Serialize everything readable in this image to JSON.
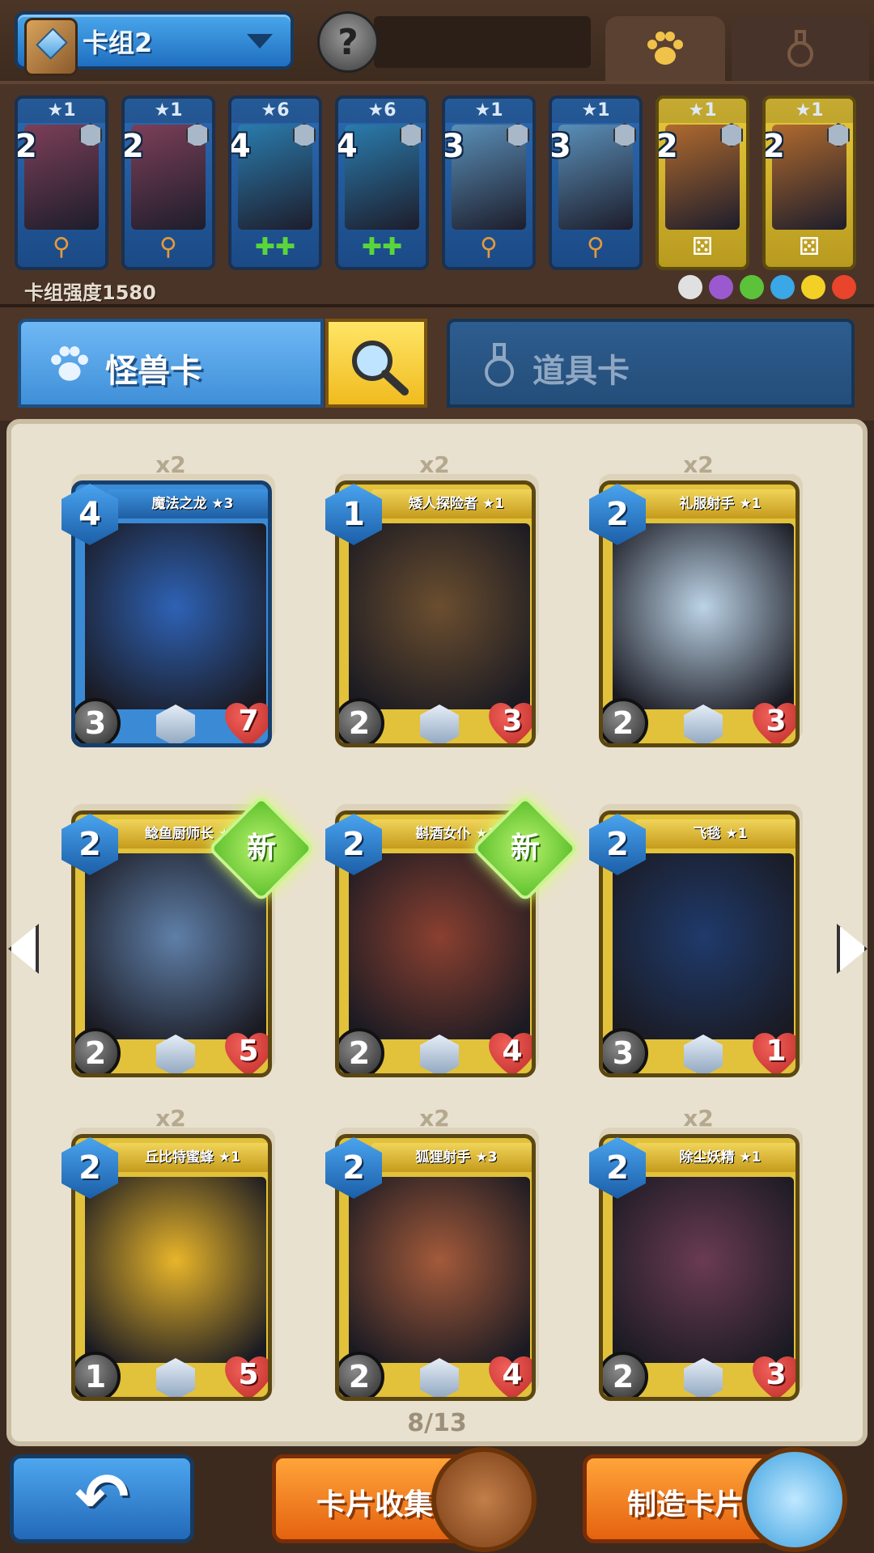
{
  "header": {
    "deck_name": "卡组2",
    "avatar_glyph": "?",
    "tabs": [
      {
        "id": "monsters",
        "icon": "paw-icon",
        "active": true
      },
      {
        "id": "items",
        "icon": "potion-flask-icon",
        "active": false
      }
    ]
  },
  "deck": {
    "cards": [
      {
        "stars": "★1",
        "cost": "2",
        "frame": "blue",
        "art_color": "#7c3f58",
        "ability_icon": "staff-icon",
        "ability_glyph": "⚲"
      },
      {
        "stars": "★1",
        "cost": "2",
        "frame": "blue",
        "art_color": "#7c3f58",
        "ability_icon": "staff-icon",
        "ability_glyph": "⚲"
      },
      {
        "stars": "★6",
        "cost": "4",
        "frame": "blue",
        "art_color": "#2a7cae",
        "ability_icon": "heal-plus-icon",
        "ability_glyph": "✚✚"
      },
      {
        "stars": "★6",
        "cost": "4",
        "frame": "blue",
        "art_color": "#2a7cae",
        "ability_icon": "heal-plus-icon",
        "ability_glyph": "✚✚"
      },
      {
        "stars": "★1",
        "cost": "3",
        "frame": "blue",
        "art_color": "#5a8fb8",
        "ability_icon": "staff-icon",
        "ability_glyph": "⚲"
      },
      {
        "stars": "★1",
        "cost": "3",
        "frame": "blue",
        "art_color": "#5a8fb8",
        "ability_icon": "staff-icon",
        "ability_glyph": "⚲"
      },
      {
        "stars": "★1",
        "cost": "2",
        "frame": "gold",
        "art_color": "#b06a2e",
        "ability_icon": "dice-icon",
        "ability_glyph": "⚄"
      },
      {
        "stars": "★1",
        "cost": "2",
        "frame": "gold",
        "art_color": "#b06a2e",
        "ability_icon": "dice-icon",
        "ability_glyph": "⚄"
      }
    ],
    "power_label": "卡组强度1580",
    "element_icons": [
      {
        "name": "neutral-element-icon",
        "color": "#e0e0e0"
      },
      {
        "name": "poison-element-icon",
        "color": "#9b59d0"
      },
      {
        "name": "nature-element-icon",
        "color": "#5cc23a"
      },
      {
        "name": "water-element-icon",
        "color": "#3aa7e6"
      },
      {
        "name": "electric-element-icon",
        "color": "#f2d026"
      },
      {
        "name": "fire-element-icon",
        "color": "#e8452c"
      }
    ]
  },
  "category_tabs": {
    "monster_label": "怪兽卡",
    "item_label": "道具卡"
  },
  "collection": {
    "cards": [
      {
        "count": "x2",
        "name": "魔法之龙 ★3",
        "cost": "4",
        "atk": "3",
        "hp": "7",
        "frame": "blue",
        "art_color": "#2e62b5",
        "is_new": false
      },
      {
        "count": "x2",
        "name": "矮人探险者 ★1",
        "cost": "1",
        "atk": "2",
        "hp": "3",
        "frame": "gold",
        "art_color": "#6b4e2f",
        "is_new": false
      },
      {
        "count": "x2",
        "name": "礼服射手 ★1",
        "cost": "2",
        "atk": "2",
        "hp": "3",
        "frame": "gold",
        "art_color": "#bcd3e6",
        "is_new": false
      },
      {
        "count": "",
        "name": "鲶鱼厨师长 ★1",
        "cost": "2",
        "atk": "2",
        "hp": "5",
        "frame": "gold",
        "art_color": "#5f7fa8",
        "is_new": true
      },
      {
        "count": "",
        "name": "斟酒女仆 ★1",
        "cost": "2",
        "atk": "2",
        "hp": "4",
        "frame": "gold",
        "art_color": "#8a4030",
        "is_new": true
      },
      {
        "count": "",
        "name": "飞毯 ★1",
        "cost": "2",
        "atk": "3",
        "hp": "1",
        "frame": "gold",
        "art_color": "#1f3a6b",
        "is_new": false
      },
      {
        "count": "x2",
        "name": "丘比特蜜蜂 ★1",
        "cost": "2",
        "atk": "1",
        "hp": "5",
        "frame": "gold",
        "art_color": "#e8b52a",
        "is_new": false
      },
      {
        "count": "x2",
        "name": "狐狸射手 ★3",
        "cost": "2",
        "atk": "2",
        "hp": "4",
        "frame": "gold",
        "art_color": "#a35a3a",
        "is_new": false
      },
      {
        "count": "x2",
        "name": "除尘妖精 ★1",
        "cost": "2",
        "atk": "2",
        "hp": "3",
        "frame": "gold",
        "art_color": "#6a3b52",
        "is_new": false
      }
    ],
    "new_label": "新",
    "page_indicator": "8/13"
  },
  "footer": {
    "back_glyph": "↶",
    "collect_label": "卡片收集",
    "craft_label": "制造卡片"
  }
}
